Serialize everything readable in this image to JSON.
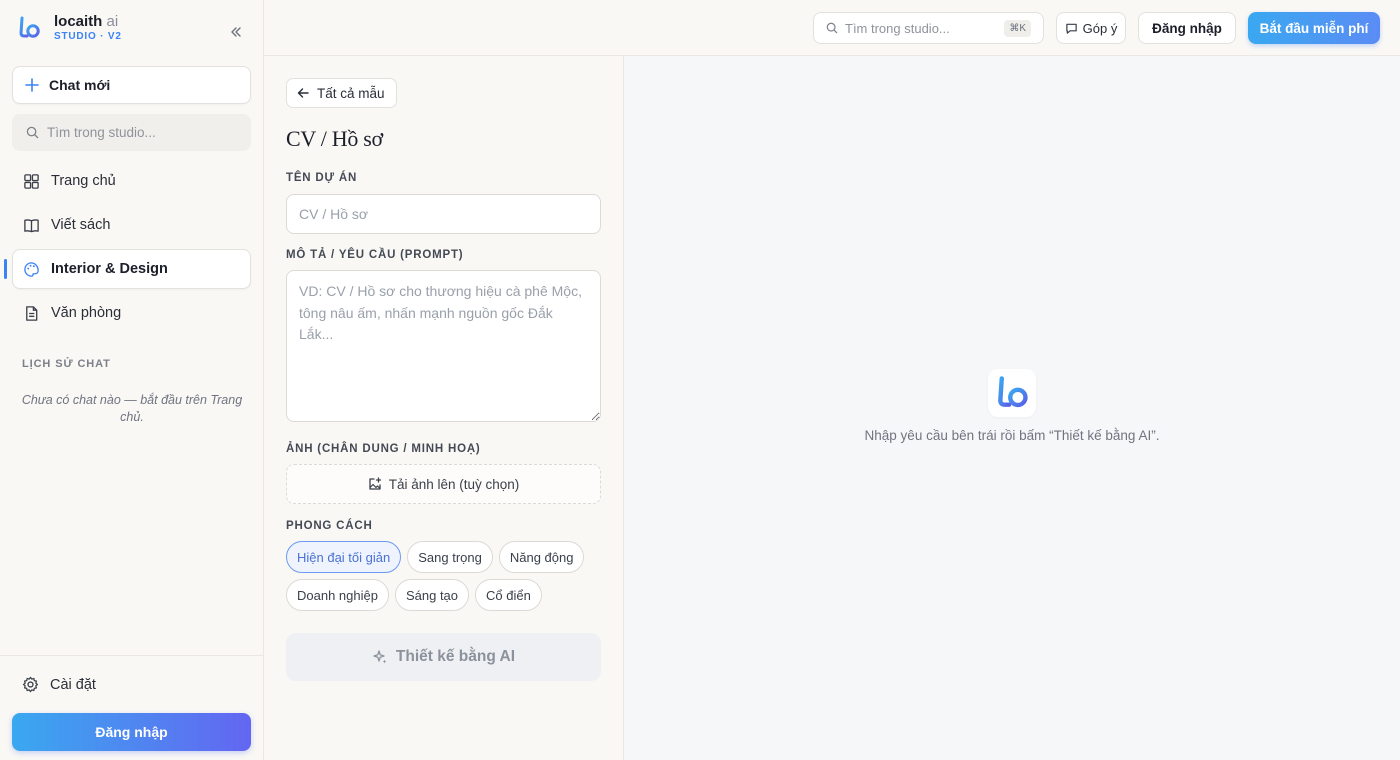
{
  "brand": {
    "name": "locaith",
    "name_suffix": "ai",
    "subtitle": "STUDIO · V2"
  },
  "sidebar": {
    "new_chat_label": "Chat mới",
    "search_placeholder": "Tìm trong studio...",
    "nav_items": [
      {
        "label": "Trang chủ",
        "icon": "grid-icon"
      },
      {
        "label": "Viết sách",
        "icon": "book-icon"
      },
      {
        "label": "Interior & Design",
        "icon": "palette-icon",
        "active": true
      },
      {
        "label": "Văn phòng",
        "icon": "document-icon"
      }
    ],
    "history_title": "LỊCH SỬ CHAT",
    "history_empty": "Chưa có chat nào — bắt đầu trên Trang chủ.",
    "settings_label": "Cài đặt",
    "login_label": "Đăng nhập"
  },
  "topbar": {
    "search_placeholder": "Tìm trong studio...",
    "shortcut": "⌘K",
    "feedback_label": "Góp ý",
    "login_label": "Đăng nhập",
    "start_label": "Bắt đầu miễn phí"
  },
  "form": {
    "back_label": "Tất cả mẫu",
    "title": "CV / Hồ sơ",
    "project_name_label": "TÊN DỰ ÁN",
    "project_name_placeholder": "CV / Hồ sơ",
    "prompt_label": "MÔ TẢ / YÊU CẦU (PROMPT)",
    "prompt_placeholder": "VD: CV / Hồ sơ cho thương hiệu cà phê Mộc, tông nâu ấm, nhấn mạnh nguồn gốc Đắk Lắk...",
    "image_label": "ẢNH (CHÂN DUNG / MINH HOẠ)",
    "upload_label": "Tải ảnh lên (tuỳ chọn)",
    "style_label": "PHONG CÁCH",
    "styles": [
      "Hiện đại tối giản",
      "Sang trọng",
      "Năng động",
      "Doanh nghiệp",
      "Sáng tạo",
      "Cổ điển"
    ],
    "selected_style": "Hiện đại tối giản",
    "design_button_label": "Thiết kế bằng AI"
  },
  "preview": {
    "hint": "Nhập yêu cầu bên trái rồi bấm “Thiết kế bằng AI”."
  },
  "colors": {
    "accent": "#3b82f6",
    "accent_gradient_end": "#6366f1"
  }
}
